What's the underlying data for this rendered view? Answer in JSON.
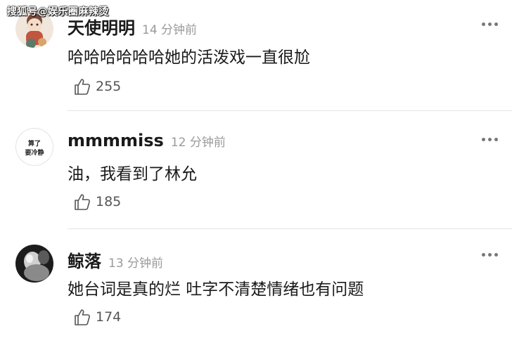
{
  "watermark": "搜狐号@娱乐圈麻辣烫",
  "comments": [
    {
      "username": "天使明明",
      "time": "14 分钟前",
      "text": "哈哈哈哈哈哈她的活泼戏一直很尬",
      "likes": "255",
      "avatar_icon": "cartoon-character-avatar"
    },
    {
      "username": "mmmmiss",
      "time": "12 分钟前",
      "text": "油，我看到了林允",
      "likes": "185",
      "avatar_icon": "text-sticker-avatar",
      "avatar_text": [
        "算了",
        "要冷静"
      ]
    },
    {
      "username": "鲸落",
      "time": "13 分钟前",
      "text": "她台词是真的烂 吐字不清楚情绪也有问题",
      "likes": "174",
      "avatar_icon": "monochrome-photo-avatar"
    }
  ],
  "icons": {
    "like": "thumbs-up-icon",
    "more": "more-options-icon"
  }
}
